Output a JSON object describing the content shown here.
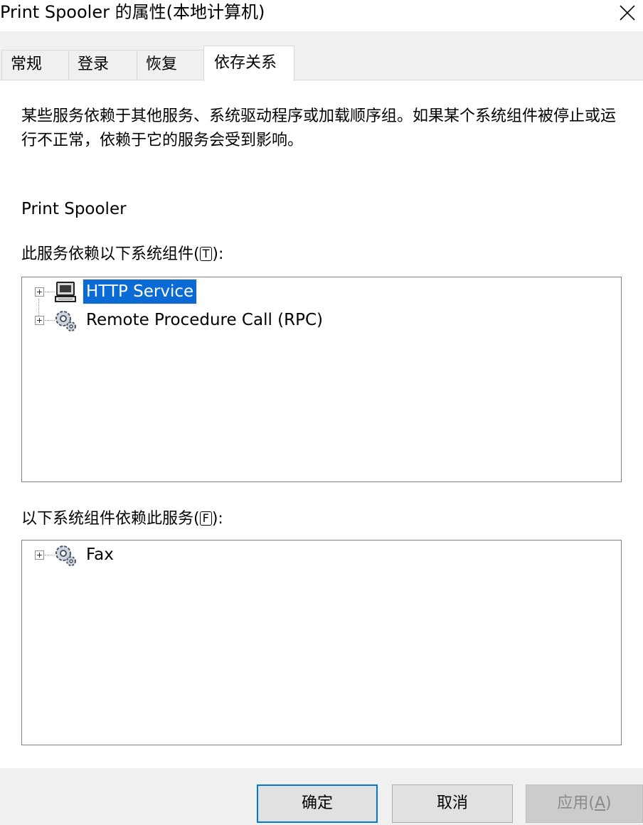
{
  "window": {
    "title": "Print Spooler 的属性(本地计算机)",
    "close_icon": "close-icon"
  },
  "tabs": [
    {
      "label": "常规",
      "active": false
    },
    {
      "label": "登录",
      "active": false
    },
    {
      "label": "恢复",
      "active": false
    },
    {
      "label": "依存关系",
      "active": true
    }
  ],
  "panel": {
    "description": "某些服务依赖于其他服务、系统驱动程序或加载顺序组。如果某个系统组件被停止或运行不正常，依赖于它的服务会受到影响。",
    "service_name": "Print Spooler",
    "depends_on": {
      "label": "此服务依赖以下系统组件",
      "accelerator": "T",
      "label_suffix": ":",
      "items": [
        {
          "label": "HTTP Service",
          "icon": "computer-icon",
          "selected": true
        },
        {
          "label": "Remote Procedure Call (RPC)",
          "icon": "gear-service-icon",
          "selected": false
        }
      ]
    },
    "dependents": {
      "label": "以下系统组件依赖此服务",
      "accelerator": "F",
      "label_suffix": ":",
      "items": [
        {
          "label": "Fax",
          "icon": "gear-service-icon",
          "selected": false
        }
      ]
    }
  },
  "buttons": {
    "ok": "确定",
    "cancel": "取消",
    "apply": "应用",
    "apply_accelerator": "A",
    "apply_enabled": false
  },
  "colors": {
    "selection": "#0a6ad6",
    "default_button_border": "#0078d7",
    "dialog_background": "#f0f0f0"
  }
}
